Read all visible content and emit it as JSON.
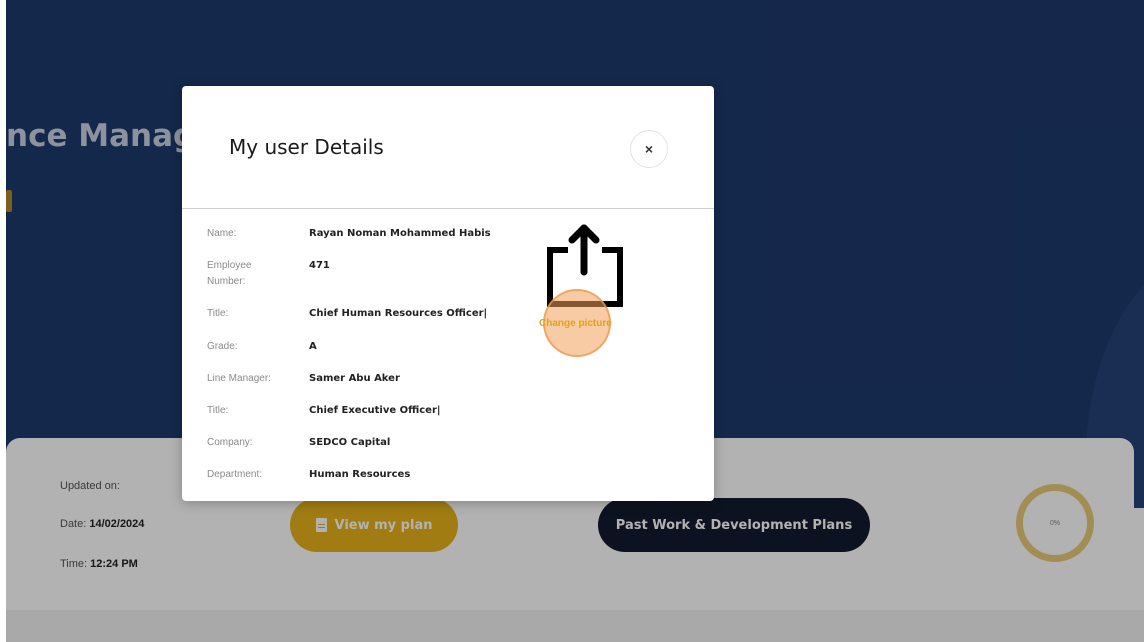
{
  "background": {
    "hero_title": "nce Manag",
    "updated_label": "Updated on:",
    "date_label": "Date:",
    "date_value": "14/02/2024",
    "time_label": "Time:",
    "time_value": "12:24 PM",
    "view_plan_label": "View my plan",
    "past_plans_label": "Past Work & Development Plans",
    "progress_text": "0%"
  },
  "modal": {
    "title": "My user Details",
    "close_symbol": "×",
    "change_picture_label": "Change picture",
    "fields": [
      {
        "label": "Name:",
        "value": "Rayan Noman Mohammed Habis"
      },
      {
        "label": "Employee Number:",
        "value": "471"
      },
      {
        "label": "Title:",
        "value": "Chief Human Resources Officer|"
      },
      {
        "label": "Grade:",
        "value": "A"
      },
      {
        "label": "Line Manager:",
        "value": "Samer Abu Aker"
      },
      {
        "label": "Title:",
        "value": "Chief Executive Officer|"
      },
      {
        "label": "Company:",
        "value": "SEDCO Capital"
      },
      {
        "label": "Department:",
        "value": "Human Resources"
      }
    ]
  },
  "colors": {
    "hero_bg": "#1e3a6c",
    "plan_button": "#e5b21b",
    "past_button": "#141a2e",
    "change_picture_highlight": "#f4a05a"
  },
  "icons": [
    "close-icon",
    "document-icon",
    "share-icon"
  ]
}
